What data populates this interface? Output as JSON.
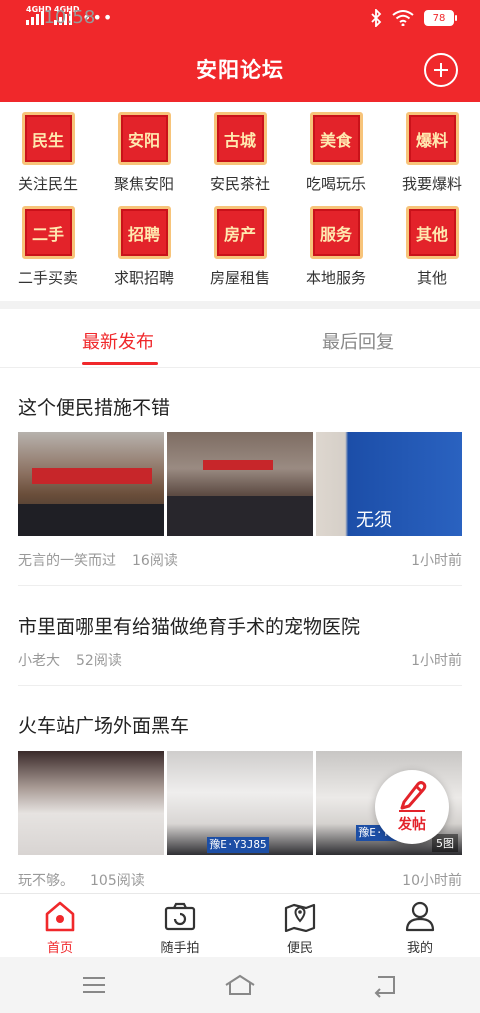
{
  "status_bar": {
    "network_1": "4GHD",
    "network_2": "4GHD",
    "time": "10:58",
    "dots": "•••",
    "battery": "78"
  },
  "header": {
    "title": "安阳论坛"
  },
  "categories": [
    {
      "badge": "民生",
      "label": "关注民生"
    },
    {
      "badge": "安阳",
      "label": "聚焦安阳"
    },
    {
      "badge": "古城",
      "label": "安民茶社"
    },
    {
      "badge": "美食",
      "label": "吃喝玩乐"
    },
    {
      "badge": "爆料",
      "label": "我要爆料"
    },
    {
      "badge": "二手",
      "label": "二手买卖"
    },
    {
      "badge": "招聘",
      "label": "求职招聘"
    },
    {
      "badge": "房产",
      "label": "房屋租售"
    },
    {
      "badge": "服务",
      "label": "本地服务"
    },
    {
      "badge": "其他",
      "label": "其他"
    }
  ],
  "tabs": [
    {
      "label": "最新发布",
      "active": true
    },
    {
      "label": "最后回复",
      "active": false
    }
  ],
  "posts": [
    {
      "title": "这个便民措施不错",
      "author": "无言的一笑而过",
      "reads": "16阅读",
      "time": "1小时前",
      "image_text": "无须"
    },
    {
      "title": "市里面哪里有给猫做绝育手术的宠物医院",
      "author": "小老大",
      "reads": "52阅读",
      "time": "1小时前"
    },
    {
      "title": "火车站广场外面黑车",
      "author": "玩不够。",
      "reads": "105阅读",
      "time": "10小时前",
      "image_count": "5图",
      "plate_1": "豫E·Y3J85",
      "plate_2": "豫E·Y3J85"
    }
  ],
  "fab": {
    "label": "发帖"
  },
  "bottom_nav": [
    {
      "label": "首页",
      "icon": "home-icon",
      "active": true
    },
    {
      "label": "随手拍",
      "icon": "camera-icon",
      "active": false
    },
    {
      "label": "便民",
      "icon": "map-icon",
      "active": false
    },
    {
      "label": "我的",
      "icon": "user-icon",
      "active": false
    }
  ],
  "colors": {
    "accent": "#f0282b",
    "badge_fill": "#e3232a",
    "badge_border": "#f7c47a"
  }
}
